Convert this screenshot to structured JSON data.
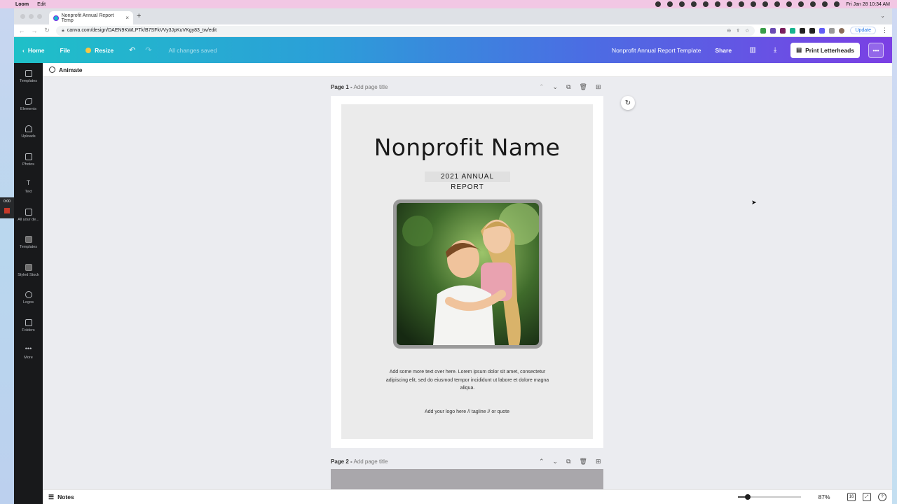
{
  "menubar": {
    "apple": "",
    "app_name": "Loom",
    "menu_edit": "Edit",
    "datetime": "Fri Jan 28  10:34 AM"
  },
  "browser": {
    "tab_title": "Nonprofit Annual Report Temp",
    "tab_close": "×",
    "new_tab": "+",
    "url": "canva.com/design/DAEN9KWLPTk/B7SFkVVy3JpKuVKgy83_tw/edit",
    "update_label": "Update"
  },
  "canva_header": {
    "home": "Home",
    "file": "File",
    "resize": "Resize",
    "saved_status": "All changes saved",
    "design_title": "Nonprofit Annual Report Template",
    "share": "Share",
    "print_button": "Print Letterheads",
    "more": "•••"
  },
  "sidebar": {
    "items": [
      {
        "label": "Templates"
      },
      {
        "label": "Elements"
      },
      {
        "label": "Uploads"
      },
      {
        "label": "Photos"
      },
      {
        "label": "Text"
      },
      {
        "label": "All your de..."
      },
      {
        "label": "Templates"
      },
      {
        "label": "Styled Stock"
      },
      {
        "label": "Logos"
      },
      {
        "label": "Folders"
      },
      {
        "label": "More"
      }
    ]
  },
  "loom": {
    "timer": "0:00"
  },
  "toolbar": {
    "animate": "Animate"
  },
  "page1": {
    "label": "Page 1 -",
    "title_placeholder": "Add page title",
    "nonprofit_name": "Nonprofit Name",
    "report_year": "2021 ANNUAL REPORT",
    "body_text": "Add some more text over here. Lorem ipsum dolor sit amet, consectetur adipiscing elit, sed do eiusmod tempor incididunt ut labore et dolore magna aliqua.",
    "logo_line": "Add your logo here  // tagline // or quote"
  },
  "page2": {
    "label": "Page 2 -",
    "title_placeholder": "Add page title"
  },
  "bottombar": {
    "notes": "Notes",
    "zoom": "87%",
    "page_count": "16"
  },
  "colors": {
    "header_gradient_start": "#1fc0c8",
    "header_gradient_end": "#7b3fe4",
    "sidebar_bg": "#18191b",
    "menubar_bg": "#f2c7e4"
  }
}
